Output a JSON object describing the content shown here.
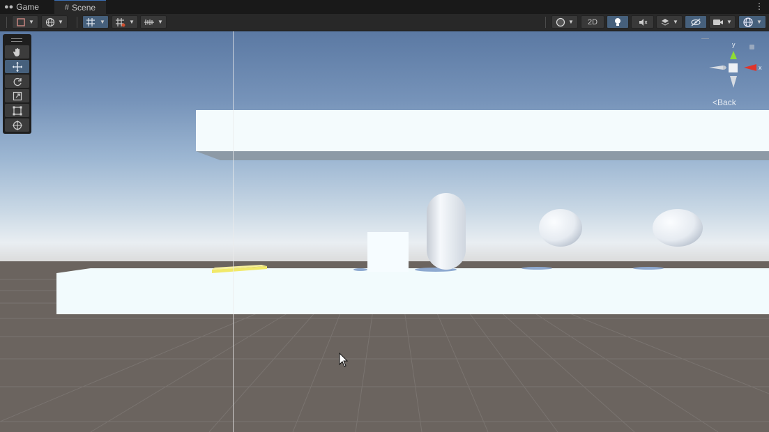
{
  "tabs": [
    {
      "label": "Game",
      "icon": "gamepad-icon"
    },
    {
      "label": "Scene",
      "icon": "hash-icon"
    }
  ],
  "toolbar": {
    "view_2d": "2D"
  },
  "tools": [
    "hand-tool",
    "move-tool",
    "rotate-tool",
    "scale-tool",
    "rect-tool",
    "transform-tool"
  ],
  "active_tool": "move-tool",
  "gizmo": {
    "axis_x": "x",
    "axis_y": "y",
    "view_label": "Back"
  },
  "colors": {
    "accent": "#46607c",
    "axis_x": "#e0352b",
    "axis_y": "#8fdc34",
    "selected_object": "#f1e96a"
  }
}
